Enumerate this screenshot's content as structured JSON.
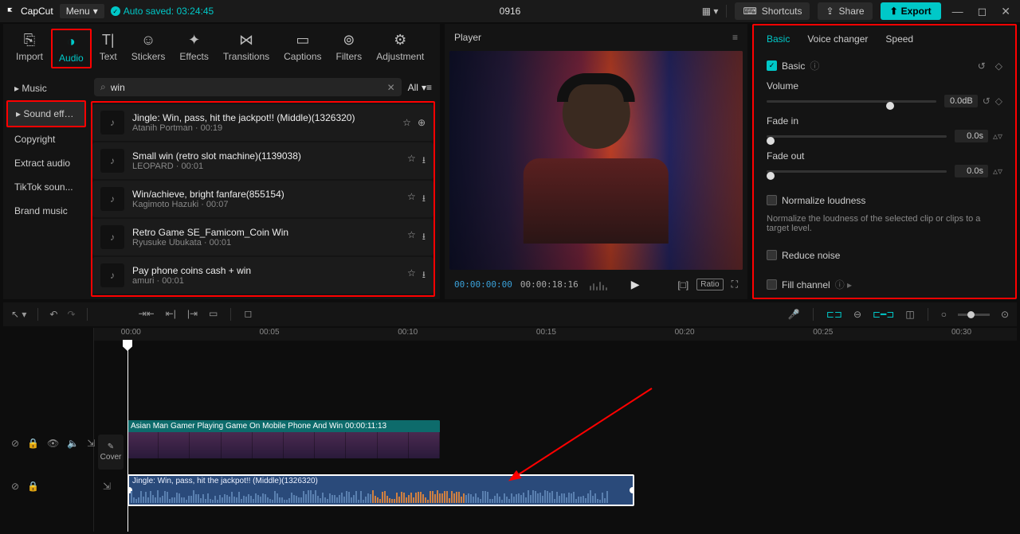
{
  "topbar": {
    "app": "CapCut",
    "menu": "Menu",
    "autosave": "Auto saved: 03:24:45",
    "project": "0916",
    "shortcuts": "Shortcuts",
    "share": "Share",
    "export": "Export"
  },
  "tabs": [
    {
      "label": "Import"
    },
    {
      "label": "Audio"
    },
    {
      "label": "Text"
    },
    {
      "label": "Stickers"
    },
    {
      "label": "Effects"
    },
    {
      "label": "Transitions"
    },
    {
      "label": "Captions"
    },
    {
      "label": "Filters"
    },
    {
      "label": "Adjustment"
    }
  ],
  "subnav": [
    "Music",
    "Sound effe...",
    "Copyright",
    "Extract audio",
    "TikTok soun...",
    "Brand music"
  ],
  "search": {
    "value": "win",
    "all": "All"
  },
  "sounds": [
    {
      "title": "Jingle: Win, pass, hit the jackpot!! (Middle)(1326320)",
      "meta": "Atanih Portman · 00:19"
    },
    {
      "title": "Small win (retro slot machine)(1139038)",
      "meta": "LEOPARD · 00:01"
    },
    {
      "title": "Win/achieve, bright fanfare(855154)",
      "meta": "Kagimoto Hazuki · 00:07"
    },
    {
      "title": "Retro Game SE_Famicom_Coin Win",
      "meta": "Ryusuke Ubukata · 00:01"
    },
    {
      "title": "Pay phone coins cash + win",
      "meta": "amuri · 00:01"
    }
  ],
  "player": {
    "label": "Player",
    "current": "00:00:00:00",
    "duration": "00:00:18:16",
    "ratio": "Ratio"
  },
  "inspector": {
    "tabs": [
      "Basic",
      "Voice changer",
      "Speed"
    ],
    "basic": "Basic",
    "volume": {
      "label": "Volume",
      "value": "0.0dB",
      "pos": 73
    },
    "fadein": {
      "label": "Fade in",
      "value": "0.0s",
      "pos": 0
    },
    "fadeout": {
      "label": "Fade out",
      "value": "0.0s",
      "pos": 0
    },
    "normalize": {
      "label": "Normalize loudness",
      "desc": "Normalize the loudness of the selected clip or clips to a target level."
    },
    "reduce": "Reduce noise",
    "fill": "Fill channel"
  },
  "timeline": {
    "ticks": [
      "00:00",
      "00:05",
      "00:10",
      "00:15",
      "00:20",
      "00:25",
      "00:30"
    ],
    "video_label": "Asian Man Gamer Playing Game On Mobile Phone And Win   00:00:11:13",
    "audio_label": "Jingle: Win, pass, hit the jackpot!! (Middle)(1326320)",
    "cover": "Cover"
  }
}
